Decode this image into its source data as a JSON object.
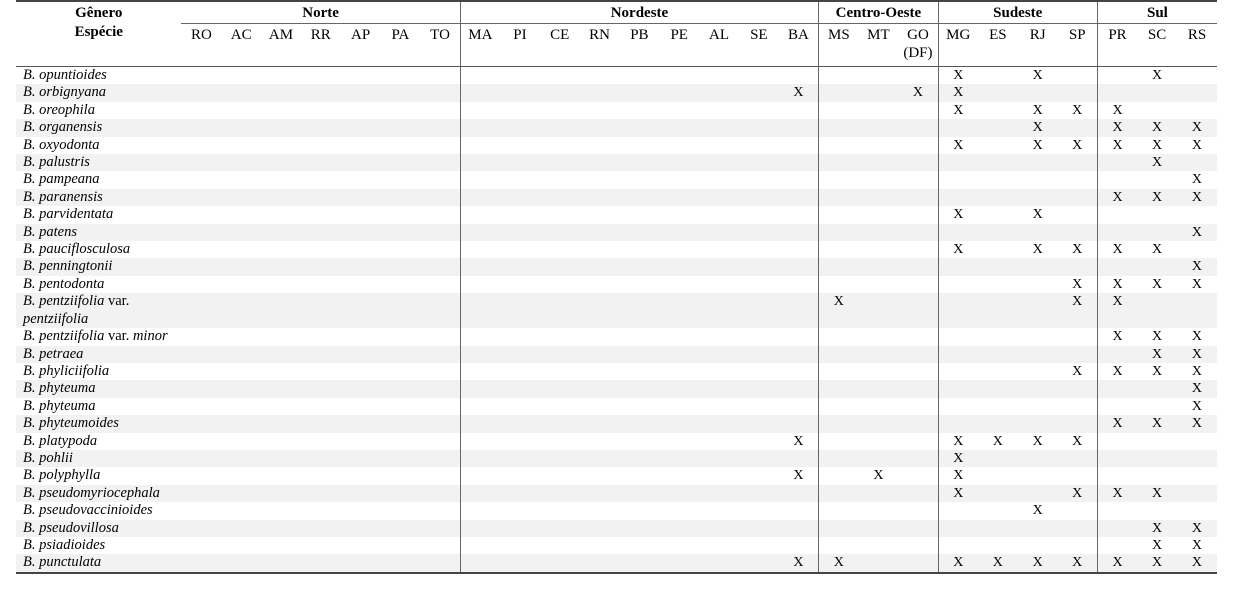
{
  "table": {
    "corner": {
      "line1": "Gênero",
      "line2": "Espécie"
    },
    "regions": [
      {
        "name": "Norte",
        "states": [
          "RO",
          "AC",
          "AM",
          "RR",
          "AP",
          "PA",
          "TO"
        ]
      },
      {
        "name": "Nordeste",
        "states": [
          "MA",
          "PI",
          "CE",
          "RN",
          "PB",
          "PE",
          "AL",
          "SE",
          "BA"
        ]
      },
      {
        "name": "Centro-Oeste",
        "states": [
          "MS",
          "MT",
          "GO"
        ],
        "state_subs": [
          "",
          "",
          "(DF)"
        ]
      },
      {
        "name": "Sudeste",
        "states": [
          "MG",
          "ES",
          "RJ",
          "SP"
        ]
      },
      {
        "name": "Sul",
        "states": [
          "PR",
          "SC",
          "RS"
        ]
      }
    ],
    "columns": [
      "RO",
      "AC",
      "AM",
      "RR",
      "AP",
      "PA",
      "TO",
      "MA",
      "PI",
      "CE",
      "RN",
      "PB",
      "PE",
      "AL",
      "SE",
      "BA",
      "MS",
      "MT",
      "GO",
      "MG",
      "ES",
      "RJ",
      "SP",
      "PR",
      "SC",
      "RS"
    ],
    "mark": "X",
    "rows": [
      {
        "genus": "B.",
        "epithet": "opuntioides",
        "marks": [
          "MG",
          "RJ",
          "SC"
        ]
      },
      {
        "genus": "B.",
        "epithet": "orbignyana",
        "marks": [
          "BA",
          "GO",
          "MG"
        ]
      },
      {
        "genus": "B.",
        "epithet": "oreophila",
        "marks": [
          "MG",
          "RJ",
          "SP",
          "PR"
        ]
      },
      {
        "genus": "B.",
        "epithet": "organensis",
        "marks": [
          "RJ",
          "PR",
          "SC",
          "RS"
        ]
      },
      {
        "genus": "B.",
        "epithet": "oxyodonta",
        "marks": [
          "MG",
          "RJ",
          "SP",
          "PR",
          "SC",
          "RS"
        ]
      },
      {
        "genus": "B.",
        "epithet": "palustris",
        "marks": [
          "SC"
        ]
      },
      {
        "genus": "B.",
        "epithet": "pampeana",
        "marks": [
          "RS"
        ]
      },
      {
        "genus": "B.",
        "epithet": "paranensis",
        "marks": [
          "PR",
          "SC",
          "RS"
        ]
      },
      {
        "genus": "B.",
        "epithet": "parvidentata",
        "marks": [
          "MG",
          "RJ"
        ]
      },
      {
        "genus": "B.",
        "epithet": "patens",
        "marks": [
          "RS"
        ]
      },
      {
        "genus": "B.",
        "epithet": "pauciflosculosa",
        "marks": [
          "MG",
          "RJ",
          "SP",
          "PR",
          "SC"
        ]
      },
      {
        "genus": "B.",
        "epithet": "penningtonii",
        "marks": [
          "RS"
        ]
      },
      {
        "genus": "B.",
        "epithet": "pentodonta",
        "marks": [
          "SP",
          "PR",
          "SC",
          "RS"
        ]
      },
      {
        "genus": "B.",
        "epithet": "pentziifolia",
        "connector": "var.",
        "variety": "pentziifolia",
        "marks": [
          "MS",
          "SP",
          "PR"
        ]
      },
      {
        "genus": "B.",
        "epithet": "pentziifolia",
        "connector": "var.",
        "variety": "minor",
        "marks": [
          "PR",
          "SC",
          "RS"
        ]
      },
      {
        "genus": "B.",
        "epithet": "petraea",
        "marks": [
          "SC",
          "RS"
        ]
      },
      {
        "genus": "B.",
        "epithet": "phyliciifolia",
        "marks": [
          "SP",
          "PR",
          "SC",
          "RS"
        ]
      },
      {
        "genus": "B.",
        "epithet": "phyteuma",
        "marks": [
          "RS"
        ]
      },
      {
        "genus": "B.",
        "epithet": "phyteuma",
        "marks": [
          "RS"
        ]
      },
      {
        "genus": "B.",
        "epithet": "phyteumoides",
        "marks": [
          "PR",
          "SC",
          "RS"
        ]
      },
      {
        "genus": "B.",
        "epithet": "platypoda",
        "marks": [
          "BA",
          "MG",
          "ES",
          "RJ",
          "SP"
        ]
      },
      {
        "genus": "B.",
        "epithet": "pohlii",
        "marks": [
          "MG"
        ]
      },
      {
        "genus": "B.",
        "epithet": "polyphylla",
        "marks": [
          "BA",
          "MT",
          "MG"
        ]
      },
      {
        "genus": "B.",
        "epithet": "pseudomyriocephala",
        "marks": [
          "MG",
          "SP",
          "PR",
          "SC"
        ]
      },
      {
        "genus": "B.",
        "epithet": "pseudovaccinioides",
        "marks": [
          "RJ"
        ]
      },
      {
        "genus": "B.",
        "epithet": "pseudovillosa",
        "marks": [
          "SC",
          "RS"
        ]
      },
      {
        "genus": "B.",
        "epithet": "psiadioides",
        "marks": [
          "SC",
          "RS"
        ]
      },
      {
        "genus": "B.",
        "epithet": "punctulata",
        "marks": [
          "BA",
          "MS",
          "MG",
          "ES",
          "RJ",
          "SP",
          "PR",
          "SC",
          "RS"
        ]
      }
    ]
  }
}
